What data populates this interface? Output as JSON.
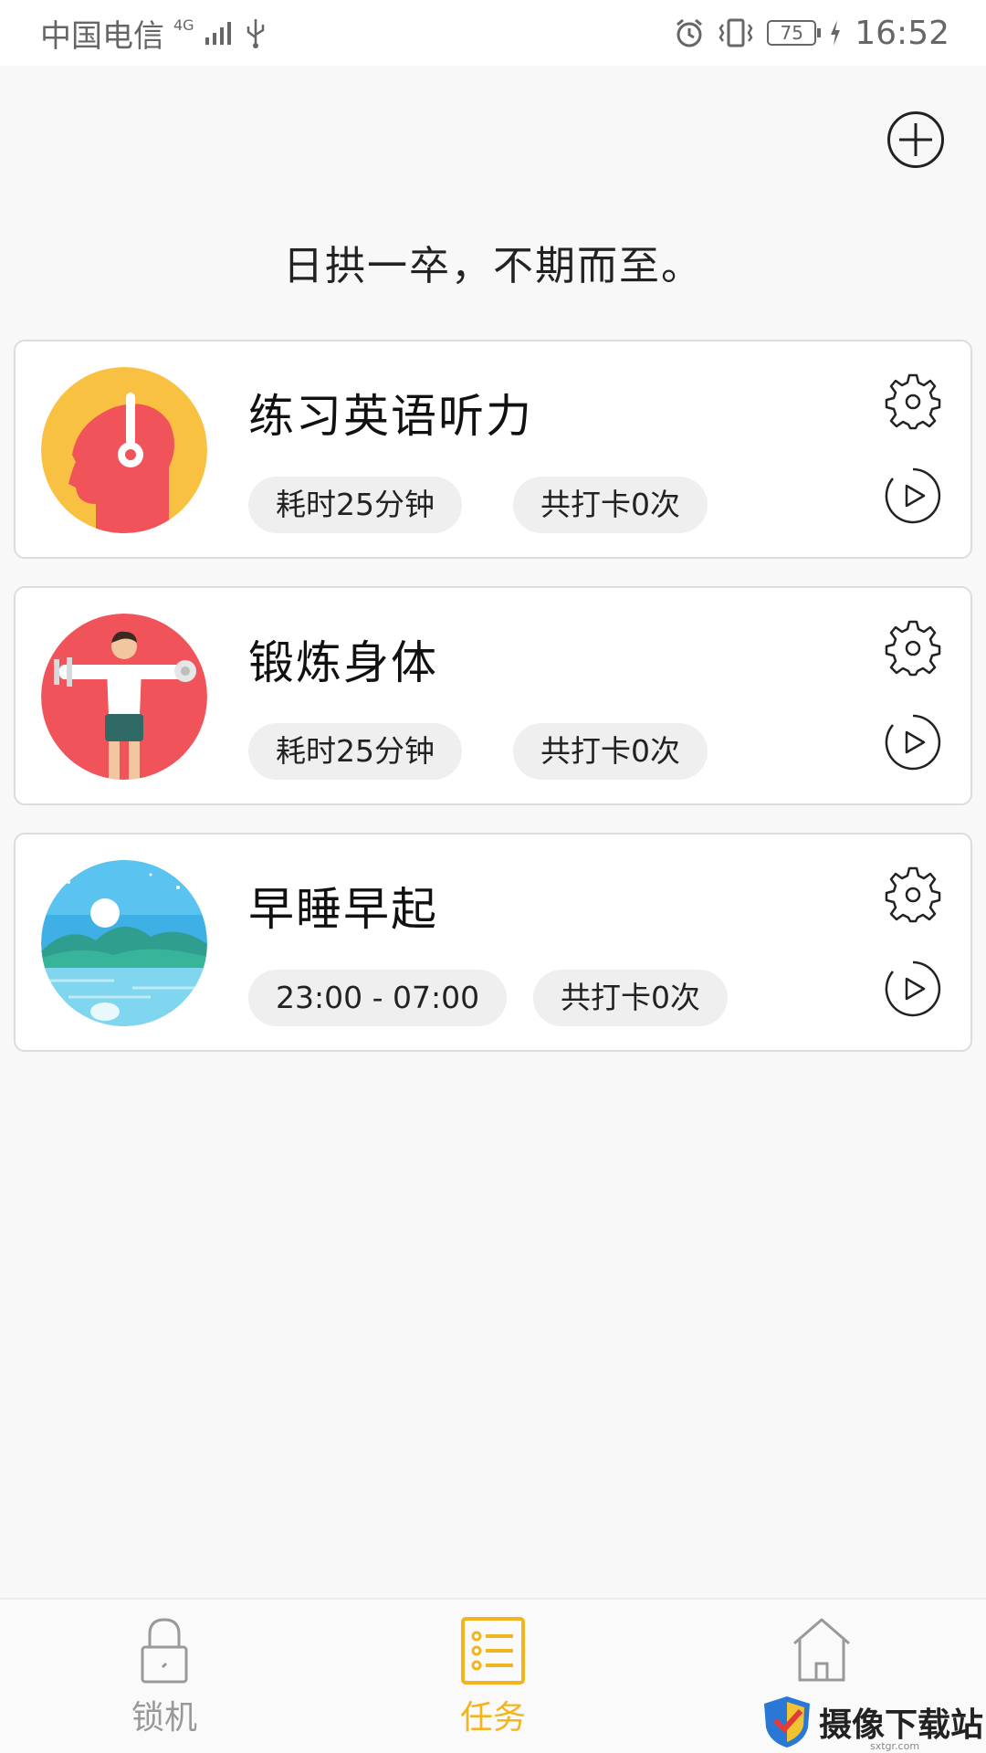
{
  "status_bar": {
    "carrier": "中国电信",
    "network": "4G",
    "time": "16:52",
    "battery": "75"
  },
  "header": {
    "add_icon": "plus-circle-icon"
  },
  "motto": "日拱一卒，不期而至。",
  "tasks": [
    {
      "title": "练习英语听力",
      "pill1": "耗时25分钟",
      "pill2": "共打卡0次",
      "avatar": "listening-head-icon"
    },
    {
      "title": "锻炼身体",
      "pill1": "耗时25分钟",
      "pill2": "共打卡0次",
      "avatar": "exercise-man-icon"
    },
    {
      "title": "早睡早起",
      "pill1": "23:00 - 07:00",
      "pill2": "共打卡0次",
      "avatar": "moon-lake-icon"
    }
  ],
  "nav": {
    "items": [
      {
        "label": "锁机",
        "icon": "lock-icon",
        "active": false
      },
      {
        "label": "任务",
        "icon": "task-list-icon",
        "active": true
      },
      {
        "label": "",
        "icon": "home-icon",
        "active": false
      }
    ],
    "active_color": "#f3b51f",
    "inactive_color": "#999999"
  },
  "watermark": {
    "text": "摄像下载站",
    "sub": "sxtgr.com"
  }
}
